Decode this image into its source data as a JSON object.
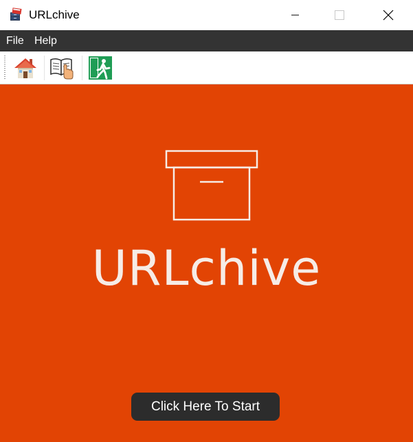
{
  "window": {
    "title": "URLchive",
    "icon": "file-cabinet-icon"
  },
  "menu": {
    "items": [
      {
        "label": "File"
      },
      {
        "label": "Help"
      }
    ]
  },
  "toolbar": {
    "buttons": [
      {
        "icon": "home-icon"
      },
      {
        "icon": "manual-book-icon"
      },
      {
        "icon": "exit-door-icon"
      }
    ]
  },
  "splash": {
    "brand_name": "URLchive",
    "start_label": "Click Here To Start",
    "background_color": "#e24404",
    "button_color": "#2c2c2c"
  }
}
